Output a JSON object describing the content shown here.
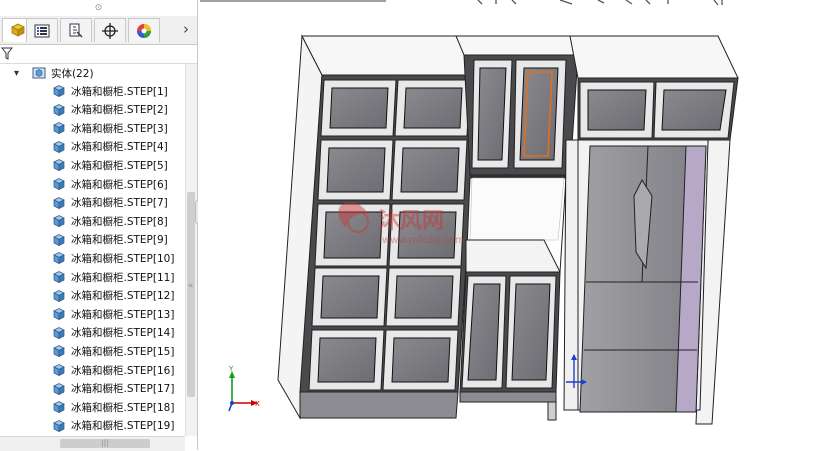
{
  "panel": {
    "grip_glyph": "⊙",
    "tabs": [
      {
        "name": "feature-manager-tab",
        "icon": "feature-tree-icon",
        "active": true
      },
      {
        "name": "property-manager-tab",
        "icon": "property-list-icon",
        "active": false
      },
      {
        "name": "configuration-manager-tab",
        "icon": "configuration-icon",
        "active": false
      },
      {
        "name": "dimxpert-manager-tab",
        "icon": "crosshair-icon",
        "active": false
      },
      {
        "name": "display-manager-tab",
        "icon": "appearance-icon",
        "active": false
      }
    ],
    "tabs_more_glyph": "›",
    "filter_icon": "filter-icon",
    "tree": {
      "folder_label": "实体(22)",
      "expand_glyph": "▾",
      "items": [
        "冰箱和橱柜.STEP[1]",
        "冰箱和橱柜.STEP[2]",
        "冰箱和橱柜.STEP[3]",
        "冰箱和橱柜.STEP[4]",
        "冰箱和橱柜.STEP[5]",
        "冰箱和橱柜.STEP[6]",
        "冰箱和橱柜.STEP[7]",
        "冰箱和橱柜.STEP[8]",
        "冰箱和橱柜.STEP[9]",
        "冰箱和橱柜.STEP[10]",
        "冰箱和橱柜.STEP[11]",
        "冰箱和橱柜.STEP[12]",
        "冰箱和橱柜.STEP[13]",
        "冰箱和橱柜.STEP[14]",
        "冰箱和橱柜.STEP[15]",
        "冰箱和橱柜.STEP[16]",
        "冰箱和橱柜.STEP[17]",
        "冰箱和橱柜.STEP[18]",
        "冰箱和橱柜.STEP[19]"
      ]
    },
    "scroll_grip": "|||"
  },
  "viewport": {
    "axis_labels": {
      "x": "X",
      "y": "Y"
    },
    "watermark_text": "沐风网",
    "watermark_url": "www.mfcad.com"
  },
  "colors": {
    "panel_bg": "#ffffff",
    "tab_bg": "#f0f0f0",
    "body_icon": "#5b9bd5",
    "cabinet_side": "#f7f7f7",
    "door_panel": "#7b7b80",
    "door_frame": "#efefef",
    "fridge": "#8c8c90",
    "highlight": "#e07020",
    "axis_x": "#cc0000",
    "axis_y": "#1a9a1a",
    "axis_z": "#1f3fcf"
  }
}
